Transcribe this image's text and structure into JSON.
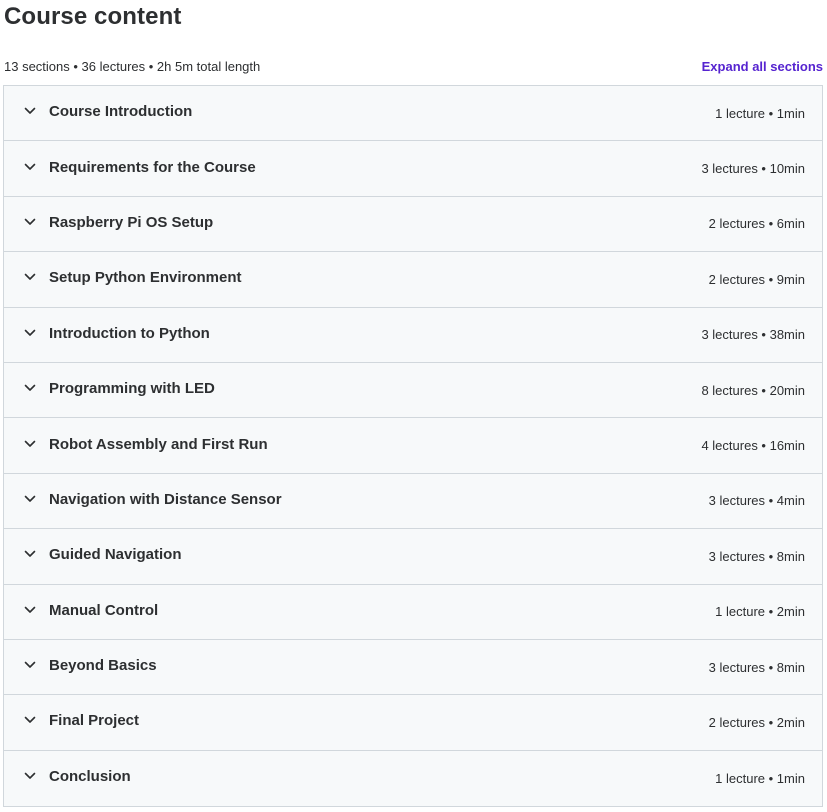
{
  "page": {
    "title": "Course content",
    "summary": "13 sections • 36 lectures • 2h 5m total length",
    "expand_label": "Expand all sections"
  },
  "sections": [
    {
      "title": "Course Introduction",
      "meta": "1 lecture • 1min"
    },
    {
      "title": "Requirements for the Course",
      "meta": "3 lectures • 10min"
    },
    {
      "title": "Raspberry Pi OS Setup",
      "meta": "2 lectures • 6min"
    },
    {
      "title": "Setup Python Environment",
      "meta": "2 lectures • 9min"
    },
    {
      "title": "Introduction to Python",
      "meta": "3 lectures • 38min"
    },
    {
      "title": "Programming with LED",
      "meta": "8 lectures • 20min"
    },
    {
      "title": "Robot Assembly and First Run",
      "meta": "4 lectures • 16min"
    },
    {
      "title": "Navigation with Distance Sensor",
      "meta": "3 lectures • 4min"
    },
    {
      "title": "Guided Navigation",
      "meta": "3 lectures • 8min"
    },
    {
      "title": "Manual Control",
      "meta": "1 lecture • 2min"
    },
    {
      "title": "Beyond Basics",
      "meta": "3 lectures • 8min"
    },
    {
      "title": "Final Project",
      "meta": "2 lectures • 2min"
    },
    {
      "title": "Conclusion",
      "meta": "1 lecture • 1min"
    }
  ],
  "icons": {
    "section_toggle": "chevron-down-icon"
  },
  "colors": {
    "text": "#2d2f31",
    "accent": "#5624d0",
    "section_bg": "#f7f9fa",
    "border": "#d1d7dc"
  }
}
